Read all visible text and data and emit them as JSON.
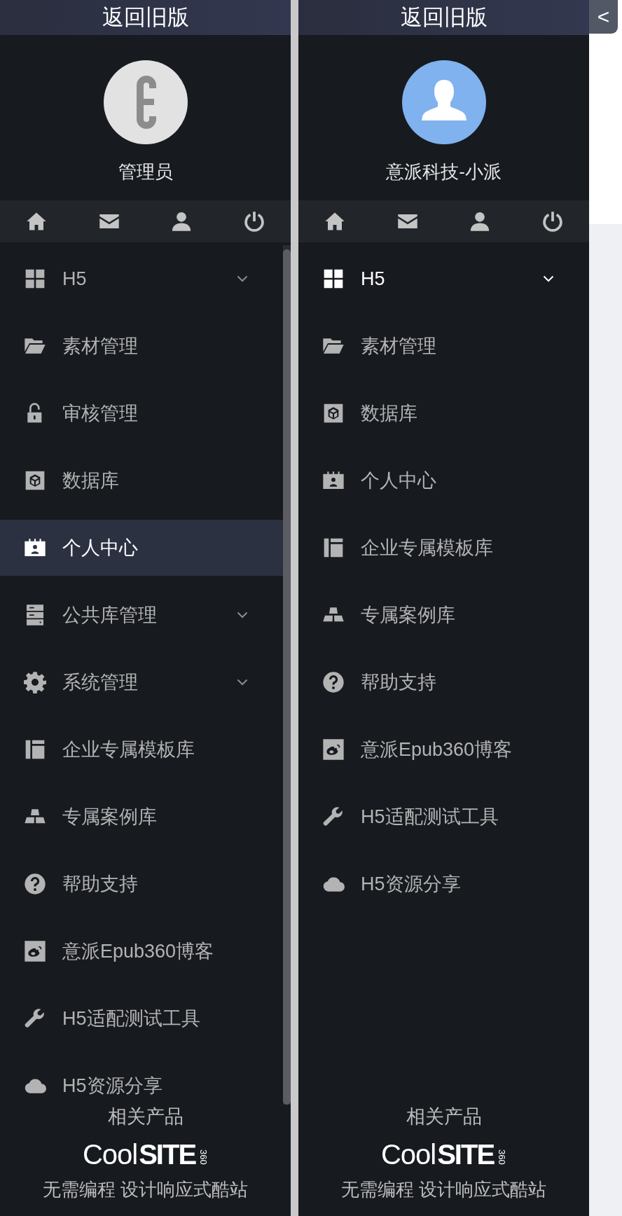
{
  "panels": [
    {
      "header": {
        "label": "返回旧版"
      },
      "user": {
        "avatar": {
          "kind": "brand"
        },
        "name": "管理员"
      },
      "scrollable": true,
      "menu": [
        {
          "label": "H5",
          "submenu": true,
          "selected": false,
          "highlighted": false
        },
        {
          "label": "素材管理",
          "submenu": false,
          "selected": false,
          "highlighted": false
        },
        {
          "label": "审核管理",
          "submenu": false,
          "selected": false,
          "highlighted": false
        },
        {
          "label": "数据库",
          "submenu": false,
          "selected": false,
          "highlighted": false
        },
        {
          "label": "个人中心",
          "submenu": false,
          "selected": true,
          "highlighted": true
        },
        {
          "label": "公共库管理",
          "submenu": true,
          "selected": false,
          "highlighted": false
        },
        {
          "label": "系统管理",
          "submenu": true,
          "selected": false,
          "highlighted": false
        },
        {
          "label": "企业专属模板库",
          "submenu": false,
          "selected": false,
          "highlighted": false
        },
        {
          "label": "专属案例库",
          "submenu": false,
          "selected": false,
          "highlighted": false
        },
        {
          "label": "帮助支持",
          "submenu": false,
          "selected": false,
          "highlighted": false
        },
        {
          "label": "意派Epub360博客",
          "submenu": false,
          "selected": false,
          "highlighted": false
        },
        {
          "label": "H5适配测试工具",
          "submenu": false,
          "selected": false,
          "highlighted": false
        },
        {
          "label": "H5资源分享",
          "submenu": false,
          "selected": false,
          "highlighted": false
        }
      ],
      "footer": {
        "title": "相关产品",
        "logo": {
          "light": "Cool",
          "bold": "SITE",
          "small": "360"
        },
        "slogan": "无需编程 设计响应式酷站"
      }
    },
    {
      "header": {
        "label": "返回旧版"
      },
      "user": {
        "avatar": {
          "kind": "default"
        },
        "name": "意派科技-小派"
      },
      "scrollable": false,
      "menu": [
        {
          "label": "H5",
          "submenu": true,
          "selected": false,
          "highlighted": true
        },
        {
          "label": "素材管理",
          "submenu": false,
          "selected": false,
          "highlighted": false
        },
        {
          "label": "数据库",
          "submenu": false,
          "selected": false,
          "highlighted": false
        },
        {
          "label": "个人中心",
          "submenu": false,
          "selected": false,
          "highlighted": false
        },
        {
          "label": "企业专属模板库",
          "submenu": false,
          "selected": false,
          "highlighted": false
        },
        {
          "label": "专属案例库",
          "submenu": false,
          "selected": false,
          "highlighted": false
        },
        {
          "label": "帮助支持",
          "submenu": false,
          "selected": false,
          "highlighted": false
        },
        {
          "label": "意派Epub360博客",
          "submenu": false,
          "selected": false,
          "highlighted": false
        },
        {
          "label": "H5适配测试工具",
          "submenu": false,
          "selected": false,
          "highlighted": false
        },
        {
          "label": "H5资源分享",
          "submenu": false,
          "selected": false,
          "highlighted": false
        }
      ],
      "footer": {
        "title": "相关产品",
        "logo": {
          "light": "Cool",
          "bold": "SITE",
          "small": "360"
        },
        "slogan": "无需编程 设计响应式酷站"
      }
    }
  ],
  "collapse_button": {
    "label": "<"
  }
}
